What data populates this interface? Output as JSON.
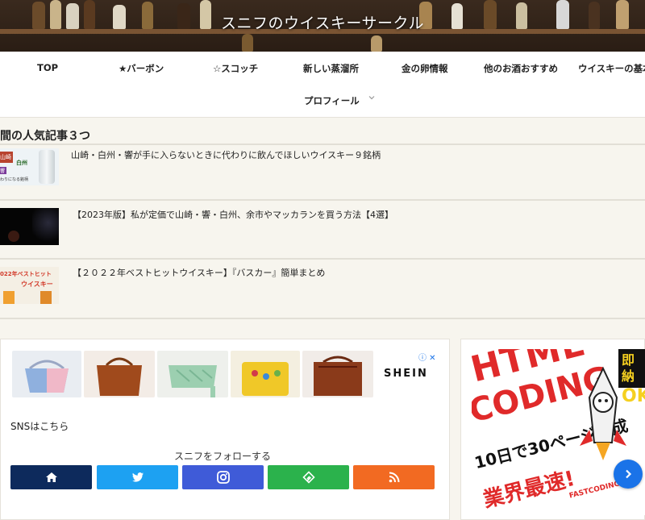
{
  "site": {
    "title": "スニフのウイスキーサークル"
  },
  "nav": {
    "items": [
      "TOP",
      "★バーボン",
      "☆スコッチ",
      "新しい蒸溜所",
      "金の卵情報",
      "他のお酒おすすめ",
      "ウイスキーの基本",
      "プロフィール"
    ]
  },
  "popular": {
    "title": "間の人気記事３つ",
    "items": [
      {
        "title": "山崎・白州・響が手に入らないときに代わりに飲んでほしいウイスキー９銘柄",
        "thumb_text": [
          "山崎",
          "白州",
          "響",
          "わりになる銘柄"
        ]
      },
      {
        "title": "【2023年版】私が定価で山崎・響・白州、余市やマッカランを買う方法【4選】"
      },
      {
        "title": "【２０２２年ベストヒットウイスキー】『バスカー』簡単まとめ",
        "thumb_text": [
          "022年ベストヒット",
          "ウイスキー"
        ]
      }
    ]
  },
  "ad": {
    "brand": "SHEIN",
    "choices": "ⓘ ✕"
  },
  "sns": {
    "label": "SNSはこちら",
    "follow": "スニフをフォローする",
    "buttons": [
      {
        "name": "home",
        "color": "#0d2a5c"
      },
      {
        "name": "twitter",
        "color": "#1da1f2"
      },
      {
        "name": "instagram",
        "color": "#3f5bd8"
      },
      {
        "name": "feedly",
        "color": "#2bb24c"
      },
      {
        "name": "rss",
        "color": "#f26a22"
      }
    ]
  },
  "banner": {
    "line1": "HTML",
    "line2": "CODING",
    "line3": "10日で30ページ作成",
    "line4": "業界最速!",
    "line5": "FASTCODING",
    "side": "即納",
    "side2": "OK"
  }
}
